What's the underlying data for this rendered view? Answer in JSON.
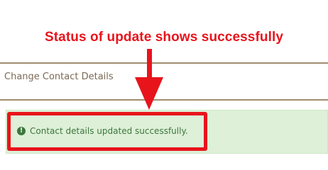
{
  "annotation": {
    "callout_text": "Status of update shows successfully",
    "color": "#e8141c"
  },
  "section": {
    "title": "Change Contact Details"
  },
  "alert": {
    "icon": "exclamation-circle-icon",
    "icon_glyph": "!",
    "message": "Contact details updated successfully.",
    "status": "success",
    "background": "#def0d8",
    "text_color": "#3c763d"
  }
}
